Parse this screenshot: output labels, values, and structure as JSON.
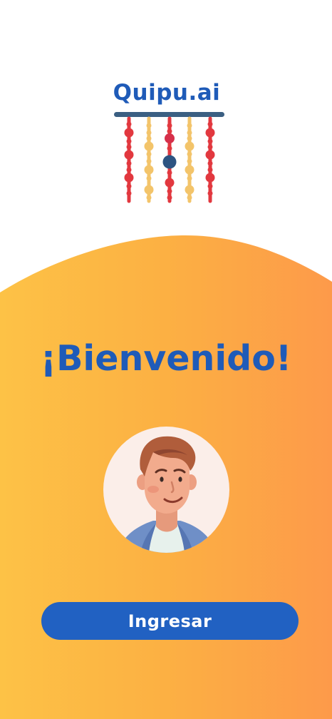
{
  "brand": {
    "name": "Quipu.ai"
  },
  "welcome": {
    "title": "¡Bienvenido!"
  },
  "actions": {
    "login_label": "Ingresar"
  },
  "colors": {
    "primary_blue": "#1f5bb8",
    "button_blue": "#2161c2",
    "gradient_start": "#fdc246",
    "gradient_end": "#fd9a4a"
  },
  "icons": {
    "logo": "quipu-knotted-cords-logo",
    "avatar": "user-avatar-illustration"
  }
}
